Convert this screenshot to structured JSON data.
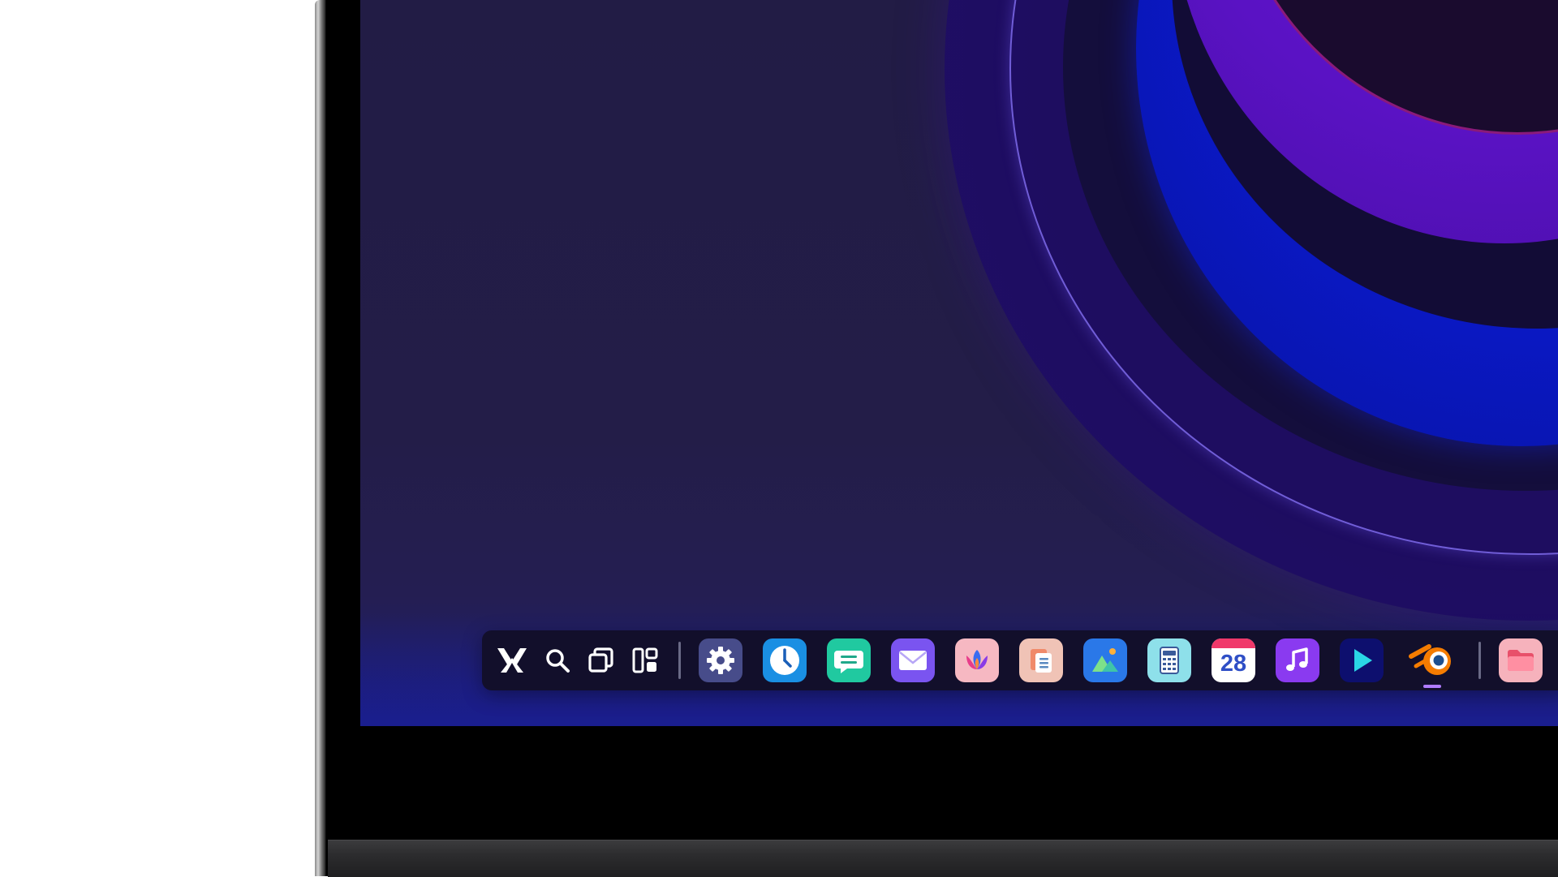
{
  "desktop": {
    "dock": {
      "system_buttons": [
        {
          "icon": "launcher-icon"
        },
        {
          "icon": "search-icon"
        },
        {
          "icon": "overview-windows-icon"
        },
        {
          "icon": "widgets-layout-icon"
        }
      ],
      "apps": [
        {
          "icon": "settings-gear-icon",
          "color": "#474c8a"
        },
        {
          "icon": "clock-icon",
          "color": "#1a8fe3"
        },
        {
          "icon": "messages-chat-icon",
          "color": "#20c9a0"
        },
        {
          "icon": "mail-envelope-icon",
          "color": "#7a54f0"
        },
        {
          "icon": "store-lotus-icon",
          "color": "#f6b8c2"
        },
        {
          "icon": "documents-icon",
          "color": "#f0c3b6"
        },
        {
          "icon": "photos-mountain-icon",
          "color": "#2a78e8"
        },
        {
          "icon": "calculator-icon",
          "color": "#8ee0ea"
        },
        {
          "icon": "calendar-icon",
          "color": "#ffffff",
          "date": "28"
        },
        {
          "icon": "music-note-icon",
          "color": "#8a3af0"
        },
        {
          "icon": "video-play-icon",
          "color": "#0d0f6e"
        },
        {
          "icon": "blender-icon",
          "color": "#f57c00",
          "running": true,
          "indicator_color": "#b07cff"
        }
      ],
      "pinned": [
        {
          "icon": "files-folder-icon",
          "color": "#f6b2bc"
        }
      ]
    }
  }
}
